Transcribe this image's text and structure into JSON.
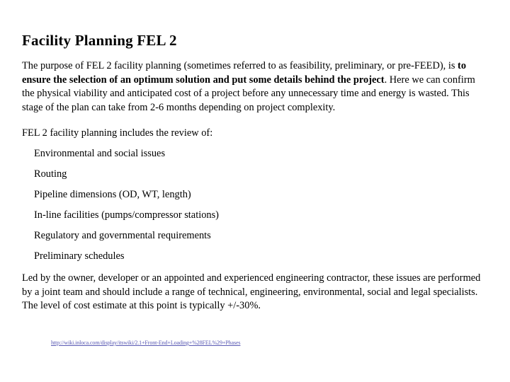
{
  "slide": {
    "title": "Facility Planning FEL 2",
    "intro": {
      "before_bold": "The purpose of FEL 2 facility planning (sometimes referred to as feasibility, preliminary, or pre-FEED), is ",
      "bold": "to ensure the selection of an optimum solution and put some details behind the project",
      "after_bold": ". Here we can confirm the physical viability and anticipated cost of a project before any unnecessary time and energy is wasted. This stage of the plan can take from 2-6 months depending on project complexity."
    },
    "lead_in": "FEL 2 facility planning includes the review of:",
    "review_items": [
      "Environmental and social issues",
      "Routing",
      "Pipeline dimensions (OD, WT, length)",
      "In-line facilities (pumps/compressor stations)",
      "Regulatory and governmental requirements",
      "Preliminary schedules"
    ],
    "closing": "Led by the owner, developer or an appointed and experienced engineering contractor, these issues are performed by a joint team and should include a range of technical, engineering, environmental, social and legal specialists. The level of cost estimate at this point is typically +/-30%.",
    "source_link": {
      "text": "http://wiki.inloca.com/display/itswiki/2.1+Front-End+Loading+%28FEL%29+Phases",
      "color": "#5a5ab4"
    }
  }
}
